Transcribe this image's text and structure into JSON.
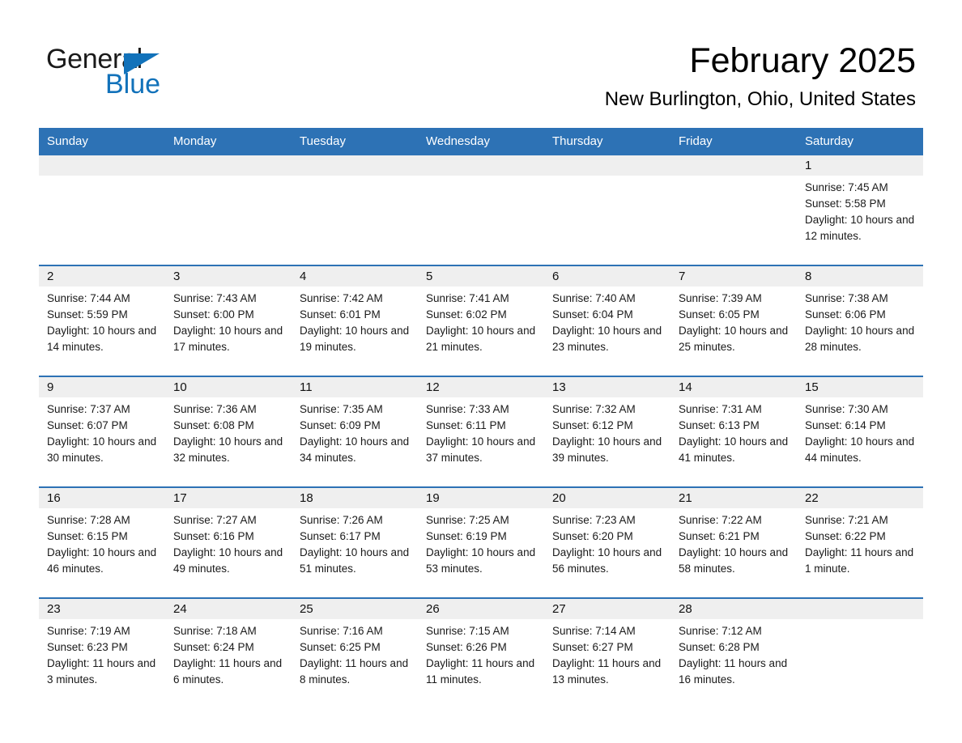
{
  "brand": {
    "name_line1": "General",
    "name_line2": "Blue",
    "accent_color": "#1272ba"
  },
  "header": {
    "title": "February 2025",
    "subtitle": "New Burlington, Ohio, United States",
    "header_bg_color": "#2d72b5",
    "daynum_band_color": "#efefef"
  },
  "weekday_headers": [
    "Sunday",
    "Monday",
    "Tuesday",
    "Wednesday",
    "Thursday",
    "Friday",
    "Saturday"
  ],
  "labels": {
    "sunrise_prefix": "Sunrise:",
    "sunset_prefix": "Sunset:",
    "daylight_prefix": "Daylight:"
  },
  "weeks": [
    [
      {
        "day": "",
        "empty": true
      },
      {
        "day": "",
        "empty": true
      },
      {
        "day": "",
        "empty": true
      },
      {
        "day": "",
        "empty": true
      },
      {
        "day": "",
        "empty": true
      },
      {
        "day": "",
        "empty": true
      },
      {
        "day": "1",
        "sunrise": "Sunrise: 7:45 AM",
        "sunset": "Sunset: 5:58 PM",
        "daylight": "Daylight: 10 hours and 12 minutes."
      }
    ],
    [
      {
        "day": "2",
        "sunrise": "Sunrise: 7:44 AM",
        "sunset": "Sunset: 5:59 PM",
        "daylight": "Daylight: 10 hours and 14 minutes."
      },
      {
        "day": "3",
        "sunrise": "Sunrise: 7:43 AM",
        "sunset": "Sunset: 6:00 PM",
        "daylight": "Daylight: 10 hours and 17 minutes."
      },
      {
        "day": "4",
        "sunrise": "Sunrise: 7:42 AM",
        "sunset": "Sunset: 6:01 PM",
        "daylight": "Daylight: 10 hours and 19 minutes."
      },
      {
        "day": "5",
        "sunrise": "Sunrise: 7:41 AM",
        "sunset": "Sunset: 6:02 PM",
        "daylight": "Daylight: 10 hours and 21 minutes."
      },
      {
        "day": "6",
        "sunrise": "Sunrise: 7:40 AM",
        "sunset": "Sunset: 6:04 PM",
        "daylight": "Daylight: 10 hours and 23 minutes."
      },
      {
        "day": "7",
        "sunrise": "Sunrise: 7:39 AM",
        "sunset": "Sunset: 6:05 PM",
        "daylight": "Daylight: 10 hours and 25 minutes."
      },
      {
        "day": "8",
        "sunrise": "Sunrise: 7:38 AM",
        "sunset": "Sunset: 6:06 PM",
        "daylight": "Daylight: 10 hours and 28 minutes."
      }
    ],
    [
      {
        "day": "9",
        "sunrise": "Sunrise: 7:37 AM",
        "sunset": "Sunset: 6:07 PM",
        "daylight": "Daylight: 10 hours and 30 minutes."
      },
      {
        "day": "10",
        "sunrise": "Sunrise: 7:36 AM",
        "sunset": "Sunset: 6:08 PM",
        "daylight": "Daylight: 10 hours and 32 minutes."
      },
      {
        "day": "11",
        "sunrise": "Sunrise: 7:35 AM",
        "sunset": "Sunset: 6:09 PM",
        "daylight": "Daylight: 10 hours and 34 minutes."
      },
      {
        "day": "12",
        "sunrise": "Sunrise: 7:33 AM",
        "sunset": "Sunset: 6:11 PM",
        "daylight": "Daylight: 10 hours and 37 minutes."
      },
      {
        "day": "13",
        "sunrise": "Sunrise: 7:32 AM",
        "sunset": "Sunset: 6:12 PM",
        "daylight": "Daylight: 10 hours and 39 minutes."
      },
      {
        "day": "14",
        "sunrise": "Sunrise: 7:31 AM",
        "sunset": "Sunset: 6:13 PM",
        "daylight": "Daylight: 10 hours and 41 minutes."
      },
      {
        "day": "15",
        "sunrise": "Sunrise: 7:30 AM",
        "sunset": "Sunset: 6:14 PM",
        "daylight": "Daylight: 10 hours and 44 minutes."
      }
    ],
    [
      {
        "day": "16",
        "sunrise": "Sunrise: 7:28 AM",
        "sunset": "Sunset: 6:15 PM",
        "daylight": "Daylight: 10 hours and 46 minutes."
      },
      {
        "day": "17",
        "sunrise": "Sunrise: 7:27 AM",
        "sunset": "Sunset: 6:16 PM",
        "daylight": "Daylight: 10 hours and 49 minutes."
      },
      {
        "day": "18",
        "sunrise": "Sunrise: 7:26 AM",
        "sunset": "Sunset: 6:17 PM",
        "daylight": "Daylight: 10 hours and 51 minutes."
      },
      {
        "day": "19",
        "sunrise": "Sunrise: 7:25 AM",
        "sunset": "Sunset: 6:19 PM",
        "daylight": "Daylight: 10 hours and 53 minutes."
      },
      {
        "day": "20",
        "sunrise": "Sunrise: 7:23 AM",
        "sunset": "Sunset: 6:20 PM",
        "daylight": "Daylight: 10 hours and 56 minutes."
      },
      {
        "day": "21",
        "sunrise": "Sunrise: 7:22 AM",
        "sunset": "Sunset: 6:21 PM",
        "daylight": "Daylight: 10 hours and 58 minutes."
      },
      {
        "day": "22",
        "sunrise": "Sunrise: 7:21 AM",
        "sunset": "Sunset: 6:22 PM",
        "daylight": "Daylight: 11 hours and 1 minute."
      }
    ],
    [
      {
        "day": "23",
        "sunrise": "Sunrise: 7:19 AM",
        "sunset": "Sunset: 6:23 PM",
        "daylight": "Daylight: 11 hours and 3 minutes."
      },
      {
        "day": "24",
        "sunrise": "Sunrise: 7:18 AM",
        "sunset": "Sunset: 6:24 PM",
        "daylight": "Daylight: 11 hours and 6 minutes."
      },
      {
        "day": "25",
        "sunrise": "Sunrise: 7:16 AM",
        "sunset": "Sunset: 6:25 PM",
        "daylight": "Daylight: 11 hours and 8 minutes."
      },
      {
        "day": "26",
        "sunrise": "Sunrise: 7:15 AM",
        "sunset": "Sunset: 6:26 PM",
        "daylight": "Daylight: 11 hours and 11 minutes."
      },
      {
        "day": "27",
        "sunrise": "Sunrise: 7:14 AM",
        "sunset": "Sunset: 6:27 PM",
        "daylight": "Daylight: 11 hours and 13 minutes."
      },
      {
        "day": "28",
        "sunrise": "Sunrise: 7:12 AM",
        "sunset": "Sunset: 6:28 PM",
        "daylight": "Daylight: 11 hours and 16 minutes."
      },
      {
        "day": "",
        "empty": true
      }
    ]
  ]
}
